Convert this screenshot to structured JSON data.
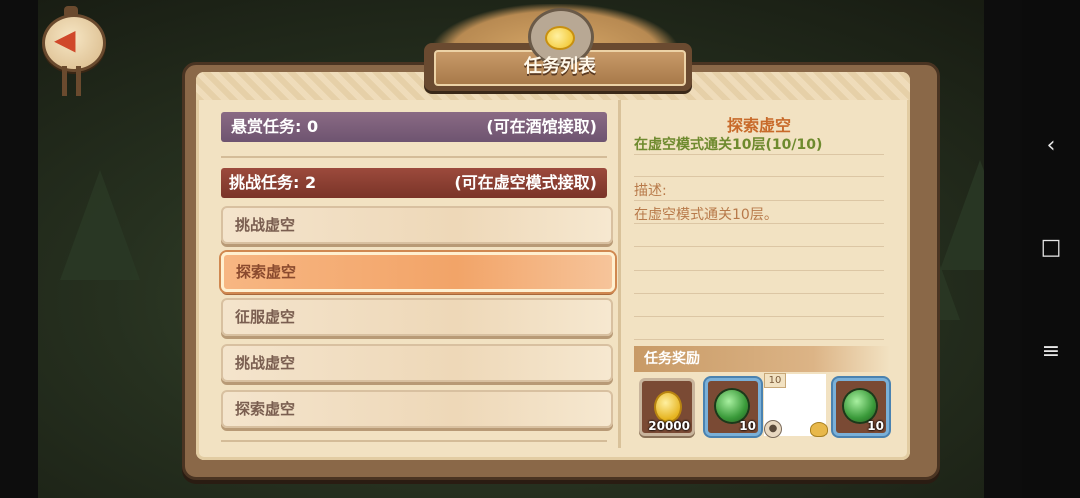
{
  "header": {
    "title": "任务列表"
  },
  "left_panel": {
    "bounty": {
      "label": "悬赏任务: 0",
      "hint": "(可在酒馆接取)"
    },
    "challenge": {
      "label": "挑战任务: 2",
      "hint": "(可在虚空模式接取)"
    },
    "tasks": [
      {
        "label": "挑战虚空",
        "selected": false
      },
      {
        "label": "探索虚空",
        "selected": true
      },
      {
        "label": "征服虚空",
        "selected": false
      },
      {
        "label": "挑战虚空",
        "selected": false
      },
      {
        "label": "探索虚空",
        "selected": false
      }
    ]
  },
  "detail": {
    "title": "探索虚空",
    "goal": "在虚空模式通关10层(10/10)",
    "desc_label": "描述:",
    "desc_text": "在虚空模式通关10层。",
    "reward_header": "任务奖励",
    "rewards": [
      {
        "icon": "gold-coin-icon",
        "count": "20000"
      },
      {
        "icon": "green-orb-icon",
        "count": "10"
      },
      {
        "icon": "blank-item",
        "badge": "10"
      },
      {
        "icon": "green-orb-icon",
        "count": "10"
      }
    ]
  },
  "nav": {
    "back": "‹",
    "home": "□",
    "menu": "≡"
  },
  "back_button_icon": "left-arrow-icon"
}
